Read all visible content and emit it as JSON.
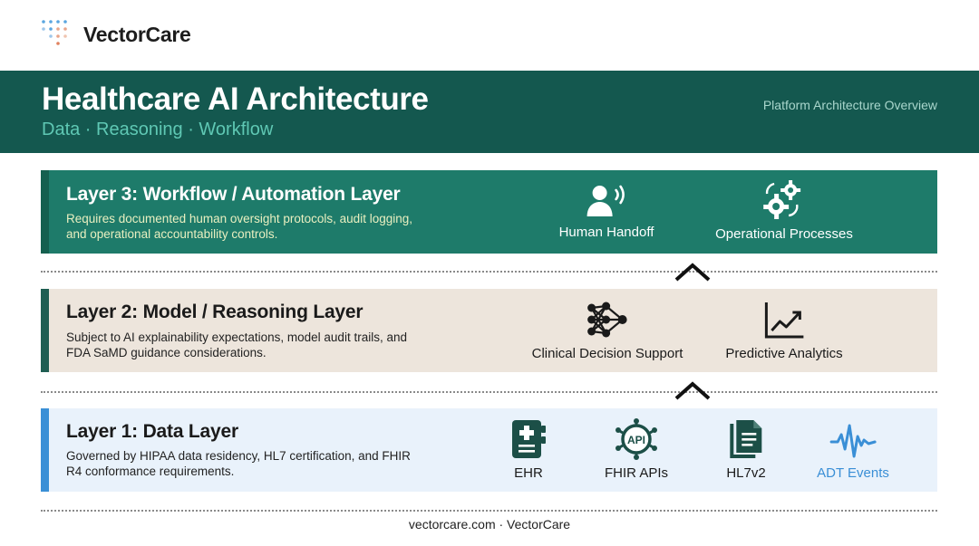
{
  "brand": {
    "name": "VectorCare"
  },
  "hero": {
    "title": "Healthcare AI Architecture",
    "subtitle": "Data · Reasoning · Workflow",
    "right_label": "Platform Architecture Overview"
  },
  "layers": [
    {
      "title": "Layer 3: Workflow / Automation Layer",
      "description": "Requires documented human oversight protocols, audit logging, and operational accountability controls.",
      "capabilities": [
        {
          "label": "Human Handoff",
          "icon": "human-handoff-icon"
        },
        {
          "label": "Operational Processes",
          "icon": "gears-icon"
        }
      ]
    },
    {
      "title": "Layer 2: Model / Reasoning Layer",
      "description": "Subject to AI explainability expectations, model audit trails, and FDA SaMD guidance considerations.",
      "capabilities": [
        {
          "label": "Clinical Decision Support",
          "icon": "neural-network-icon"
        },
        {
          "label": "Predictive Analytics",
          "icon": "line-chart-icon"
        }
      ]
    },
    {
      "title": "Layer 1: Data Layer",
      "description": "Governed by HIPAA data residency, HL7 certification, and FHIR R4 conformance requirements.",
      "capabilities": [
        {
          "label": "EHR",
          "icon": "medical-record-icon"
        },
        {
          "label": "FHIR APIs",
          "icon": "api-icon",
          "icon_text": "API"
        },
        {
          "label": "HL7v2",
          "icon": "document-icon"
        },
        {
          "label": "ADT Events",
          "icon": "waveform-icon"
        }
      ]
    }
  ],
  "colors": {
    "hero_bg": "#14584f",
    "layer3_bg": "#1e7b6a",
    "layer2_bg": "#ede5dc",
    "layer1_bg": "#e9f2fb",
    "accent_blue": "#3a8fd6",
    "icon_dark": "#1c4f47"
  },
  "footer": {
    "text": "vectorcare.com · VectorCare"
  }
}
